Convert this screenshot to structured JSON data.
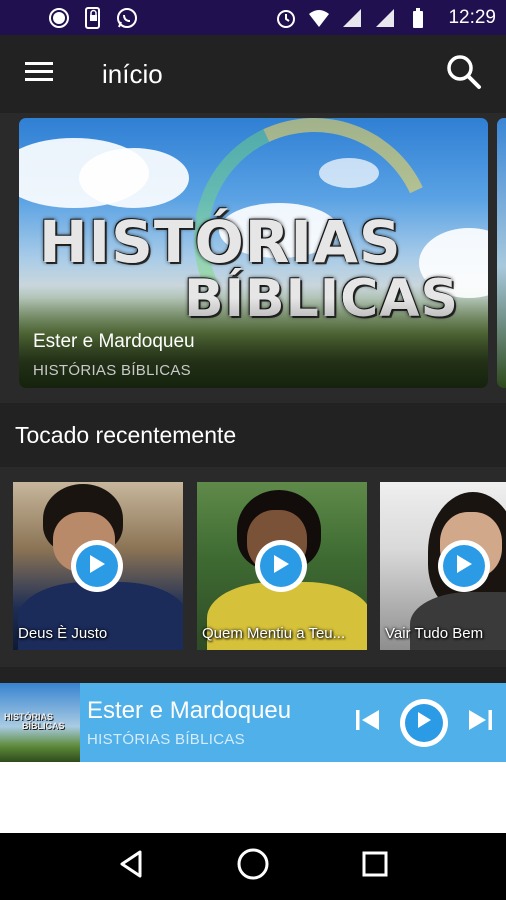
{
  "status_bar": {
    "time": "12:29",
    "left_icons": [
      "record-icon",
      "phone-lock-icon",
      "whatsapp-icon"
    ],
    "right_icons": [
      "alarm-icon",
      "wifi-icon",
      "signal-icon",
      "signal-icon",
      "battery-icon"
    ]
  },
  "app_bar": {
    "title": "início",
    "menu_icon": "hamburger-menu-icon",
    "search_icon": "search-icon"
  },
  "banner": {
    "art_line1": "HISTÓRIAS",
    "art_line2": "BÍBLICAS",
    "title": "Ester e Mardoqueu",
    "subtitle": "HISTÓRIAS BÍBLICAS"
  },
  "recent": {
    "heading": "Tocado recentemente",
    "items": [
      {
        "label": "Deus È Justo"
      },
      {
        "label": "Quem Mentiu a Teu..."
      },
      {
        "label": "Vair Tudo Bem"
      }
    ]
  },
  "mini_player": {
    "title": "Ester e Mardoqueu",
    "subtitle": "HISTÓRIAS BÍBLICAS",
    "art_text_line1": "HISTÓRIAS",
    "art_text_line2": "BÍBLICAS",
    "controls": [
      "skip-previous-icon",
      "play-icon",
      "skip-next-icon"
    ]
  },
  "nav_bar": {
    "buttons": [
      "back-icon",
      "home-icon",
      "recents-icon"
    ]
  },
  "colors": {
    "status_bar": "#21104f",
    "app_bar": "#222222",
    "background": "#2a2a2a",
    "accent": "#4fb0ea",
    "play_blue": "#2c9be6"
  }
}
